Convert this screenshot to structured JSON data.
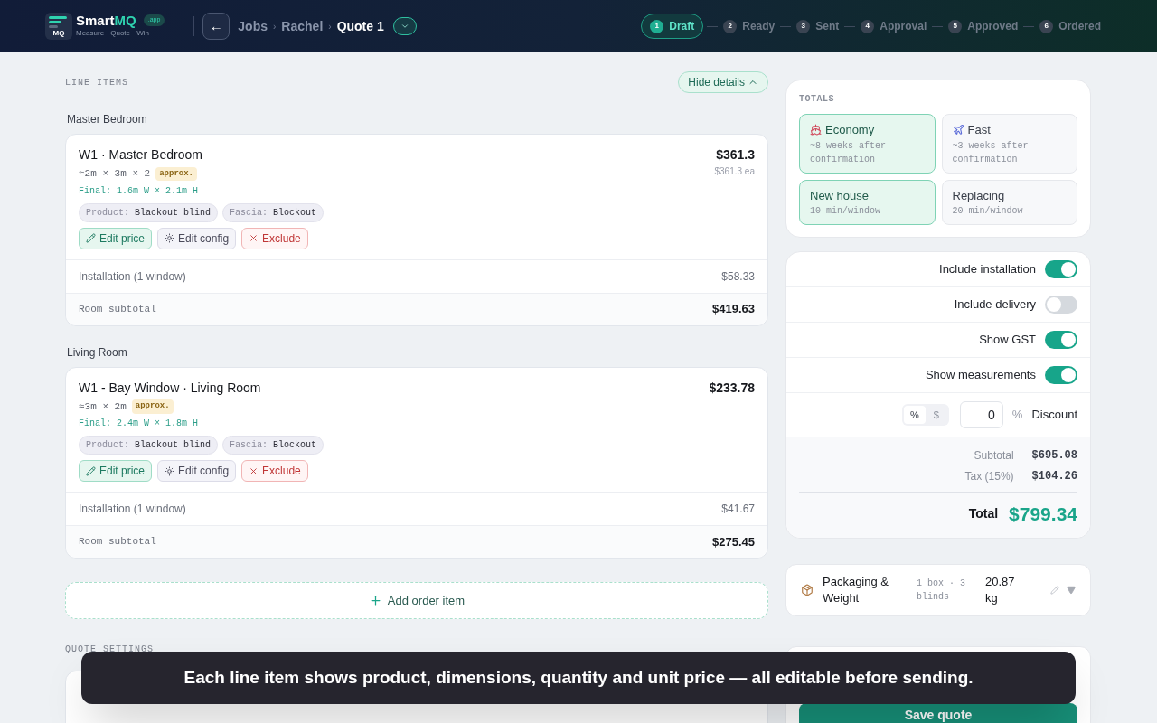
{
  "header": {
    "brand": {
      "icon_text": "MQ",
      "name_start": "Smart",
      "name_end": "MQ",
      "badge": ".app",
      "tagline": "Measure · Quote · Win"
    },
    "back_button": "←",
    "separator": "›",
    "breadcrumbs": [
      {
        "label": "Jobs",
        "current": false
      },
      {
        "label": "Rachel",
        "current": false
      },
      {
        "label": "Quote 1",
        "current": true
      }
    ],
    "steps": [
      {
        "number": "1",
        "label": "Draft",
        "selected": true
      },
      {
        "number": "2",
        "label": "Ready",
        "selected": false
      },
      {
        "number": "3",
        "label": "Sent",
        "selected": false
      },
      {
        "number": "4",
        "label": "Approval",
        "selected": false
      },
      {
        "number": "5",
        "label": "Approved",
        "selected": false
      },
      {
        "number": "6",
        "label": "Ordered",
        "selected": false
      }
    ]
  },
  "line_items": {
    "heading": "LINE ITEMS",
    "toggle": "Hide details",
    "expanded": true,
    "rooms": [
      {
        "name": "Master Bedroom",
        "items": [
          {
            "title": "W1 · Master Bedroom",
            "dims": "≈2m × 3m × 2",
            "badge": "approx.",
            "final": "Final: 1.6m W × 2.1m H",
            "tags": [
              {
                "key": "Product:",
                "value": "Blackout blind"
              },
              {
                "key": "Fascia:",
                "value": "Blockout"
              }
            ],
            "price": "$361.3",
            "unit_price": "$361.3 ea",
            "actions": [
              {
                "kind": "edit",
                "label": "Edit price"
              },
              {
                "kind": "config",
                "label": "Edit config"
              },
              {
                "kind": "exclude",
                "label": "Exclude"
              }
            ]
          }
        ],
        "installation": {
          "label": "Installation (1 window)",
          "amount": "$58.33"
        },
        "subtotal": {
          "label": "Room subtotal",
          "amount": "$419.63"
        }
      },
      {
        "name": "Living Room",
        "items": [
          {
            "title": "W1 - Bay Window · Living Room",
            "dims": "≈3m × 2m",
            "badge": "approx.",
            "final": "Final: 2.4m W × 1.8m H",
            "tags": [
              {
                "key": "Product:",
                "value": "Blackout blind"
              },
              {
                "key": "Fascia:",
                "value": "Blockout"
              }
            ],
            "price": "$233.78",
            "actions": [
              {
                "kind": "edit",
                "label": "Edit price"
              },
              {
                "kind": "config",
                "label": "Edit config"
              },
              {
                "kind": "exclude",
                "label": "Exclude"
              }
            ]
          }
        ],
        "installation": {
          "label": "Installation (1 window)",
          "amount": "$41.67"
        },
        "subtotal": {
          "label": "Room subtotal",
          "amount": "$275.45"
        }
      }
    ],
    "add_button": "Add order item"
  },
  "quote_settings": {
    "heading": "QUOTE SETTINGS"
  },
  "totals": {
    "heading": "TOTALS",
    "delivery_options": [
      {
        "kind": "ship",
        "title": "Economy",
        "subtitle": "~8 weeks after confirmation",
        "selected": true
      },
      {
        "kind": "plane",
        "title": "Fast",
        "subtitle": "~3 weeks after confirmation",
        "selected": false
      }
    ],
    "install_options": [
      {
        "title": "New house",
        "subtitle": "10 min/window",
        "selected": true
      },
      {
        "title": "Replacing",
        "subtitle": "20 min/window",
        "selected": false
      }
    ],
    "toggles": [
      {
        "label": "Include installation",
        "on": true
      },
      {
        "label": "Include delivery",
        "on": false
      },
      {
        "label": "Show GST",
        "on": true
      },
      {
        "label": "Show measurements",
        "on": true
      }
    ],
    "discount": {
      "modes": [
        {
          "label": "%",
          "selected": true
        },
        {
          "label": "$",
          "selected": false
        }
      ],
      "value": "0",
      "unit": "%",
      "label": "Discount"
    },
    "rows": [
      {
        "label": "Subtotal",
        "amount": "$695.08"
      },
      {
        "label": "Tax (15%)",
        "amount": "$104.26"
      }
    ],
    "total": {
      "label": "Total",
      "amount": "$799.34"
    }
  },
  "packaging": {
    "title": "Packaging & Weight",
    "detail": "1 box · 3 blinds",
    "weight": "20.87 kg"
  },
  "save_button": "Save quote",
  "toast": "Each line item shows product, dimensions, quantity and unit price — all editable before sending."
}
